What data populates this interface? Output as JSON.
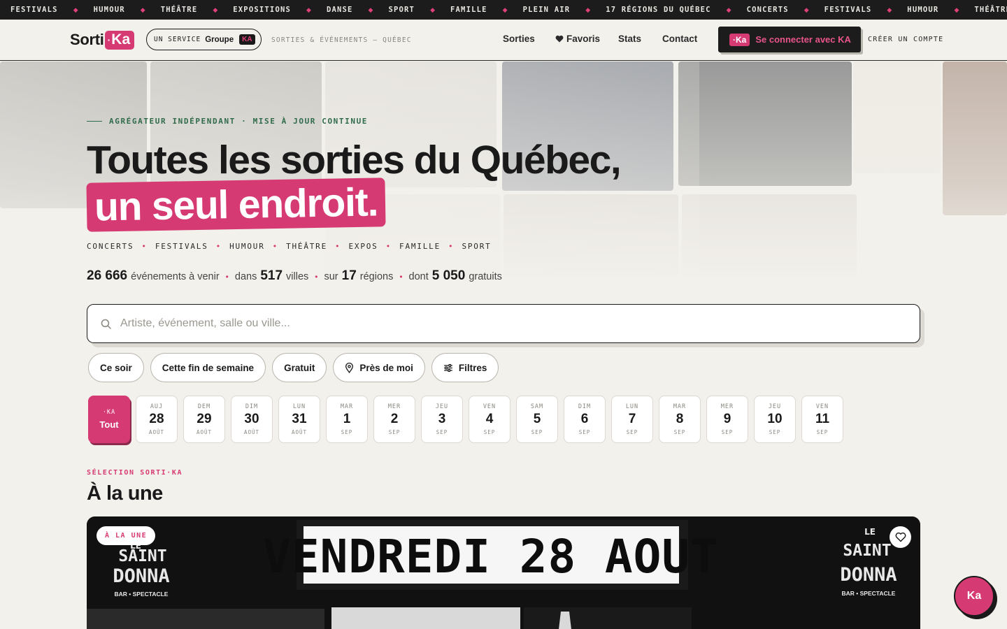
{
  "ticker": [
    "FESTIVALS",
    "HUMOUR",
    "THÉÂTRE",
    "EXPOSITIONS",
    "DANSE",
    "SPORT",
    "FAMILLE",
    "PLEIN AIR",
    "17 RÉGIONS DU QUÉBEC",
    "CONCERTS",
    "FESTIVALS",
    "HUMOUR",
    "THÉÂTRE"
  ],
  "header": {
    "logo_a": "Sorti",
    "logo_b": "Ka",
    "service_label": "UN SERVICE",
    "service_group": "Groupe",
    "service_ka": "KA",
    "tagline": "SORTIES & ÉVÉNEMENTS — QUÉBEC",
    "nav": {
      "sorties": "Sorties",
      "favoris": "Favoris",
      "stats": "Stats",
      "contact": "Contact"
    },
    "login_badge": "Ka",
    "login_label": "Se connecter avec KA",
    "create_label": "CRÉER UN COMPTE"
  },
  "hero": {
    "eyebrow": "AGRÉGATEUR INDÉPENDANT · MISE À JOUR CONTINUE",
    "title_line1": "Toutes les sorties du Québec,",
    "title_line2": "un seul endroit.",
    "categories": [
      "CONCERTS",
      "FESTIVALS",
      "HUMOUR",
      "THÉÂTRE",
      "EXPOS",
      "FAMILLE",
      "SPORT"
    ],
    "stats": {
      "events_num": "26 666",
      "events_label": "événements à venir",
      "cities_pre": "dans",
      "cities_num": "517",
      "cities_label": "villes",
      "regions_pre": "sur",
      "regions_num": "17",
      "regions_label": "régions",
      "free_pre": "dont",
      "free_num": "5 050",
      "free_label": "gratuits"
    }
  },
  "search": {
    "placeholder": "Artiste, événement, salle ou ville...",
    "value": ""
  },
  "chips": {
    "tonight": "Ce soir",
    "weekend": "Cette fin de semaine",
    "free": "Gratuit",
    "near": "Près de moi",
    "filters": "Filtres"
  },
  "dates": {
    "all_top": "·KA",
    "all_label": "Tout",
    "items": [
      {
        "dow": "AUJ",
        "day": "28",
        "mon": "AOÛT"
      },
      {
        "dow": "DEM",
        "day": "29",
        "mon": "AOÛT"
      },
      {
        "dow": "DIM",
        "day": "30",
        "mon": "AOÛT"
      },
      {
        "dow": "LUN",
        "day": "31",
        "mon": "AOÛT"
      },
      {
        "dow": "MAR",
        "day": "1",
        "mon": "SEP"
      },
      {
        "dow": "MER",
        "day": "2",
        "mon": "SEP"
      },
      {
        "dow": "JEU",
        "day": "3",
        "mon": "SEP"
      },
      {
        "dow": "VEN",
        "day": "4",
        "mon": "SEP"
      },
      {
        "dow": "SAM",
        "day": "5",
        "mon": "SEP"
      },
      {
        "dow": "DIM",
        "day": "6",
        "mon": "SEP"
      },
      {
        "dow": "LUN",
        "day": "7",
        "mon": "SEP"
      },
      {
        "dow": "MAR",
        "day": "8",
        "mon": "SEP"
      },
      {
        "dow": "MER",
        "day": "9",
        "mon": "SEP"
      },
      {
        "dow": "JEU",
        "day": "10",
        "mon": "SEP"
      },
      {
        "dow": "VEN",
        "day": "11",
        "mon": "SEP"
      }
    ]
  },
  "featured": {
    "eyebrow": "SÉLECTION SORTI·KA",
    "title": "À la une",
    "badge": "À LA UNE",
    "poster_headline": "VENDREDI 28 AOUT",
    "venue_left": [
      "LE",
      "SAINT",
      "DONNA",
      "BAR • SPECTACLE"
    ],
    "venue_right": [
      "LE",
      "SAINT",
      "DONNA",
      "BAR • SPECTACLE"
    ]
  },
  "fab_label": "Ka",
  "colors": {
    "accent": "#d63a72",
    "dark": "#1c1c1c",
    "background": "#f3f1ec",
    "green": "#2f6b4a"
  },
  "icons": [
    "search-icon",
    "heart-icon",
    "location-pin-icon",
    "sliders-icon"
  ]
}
